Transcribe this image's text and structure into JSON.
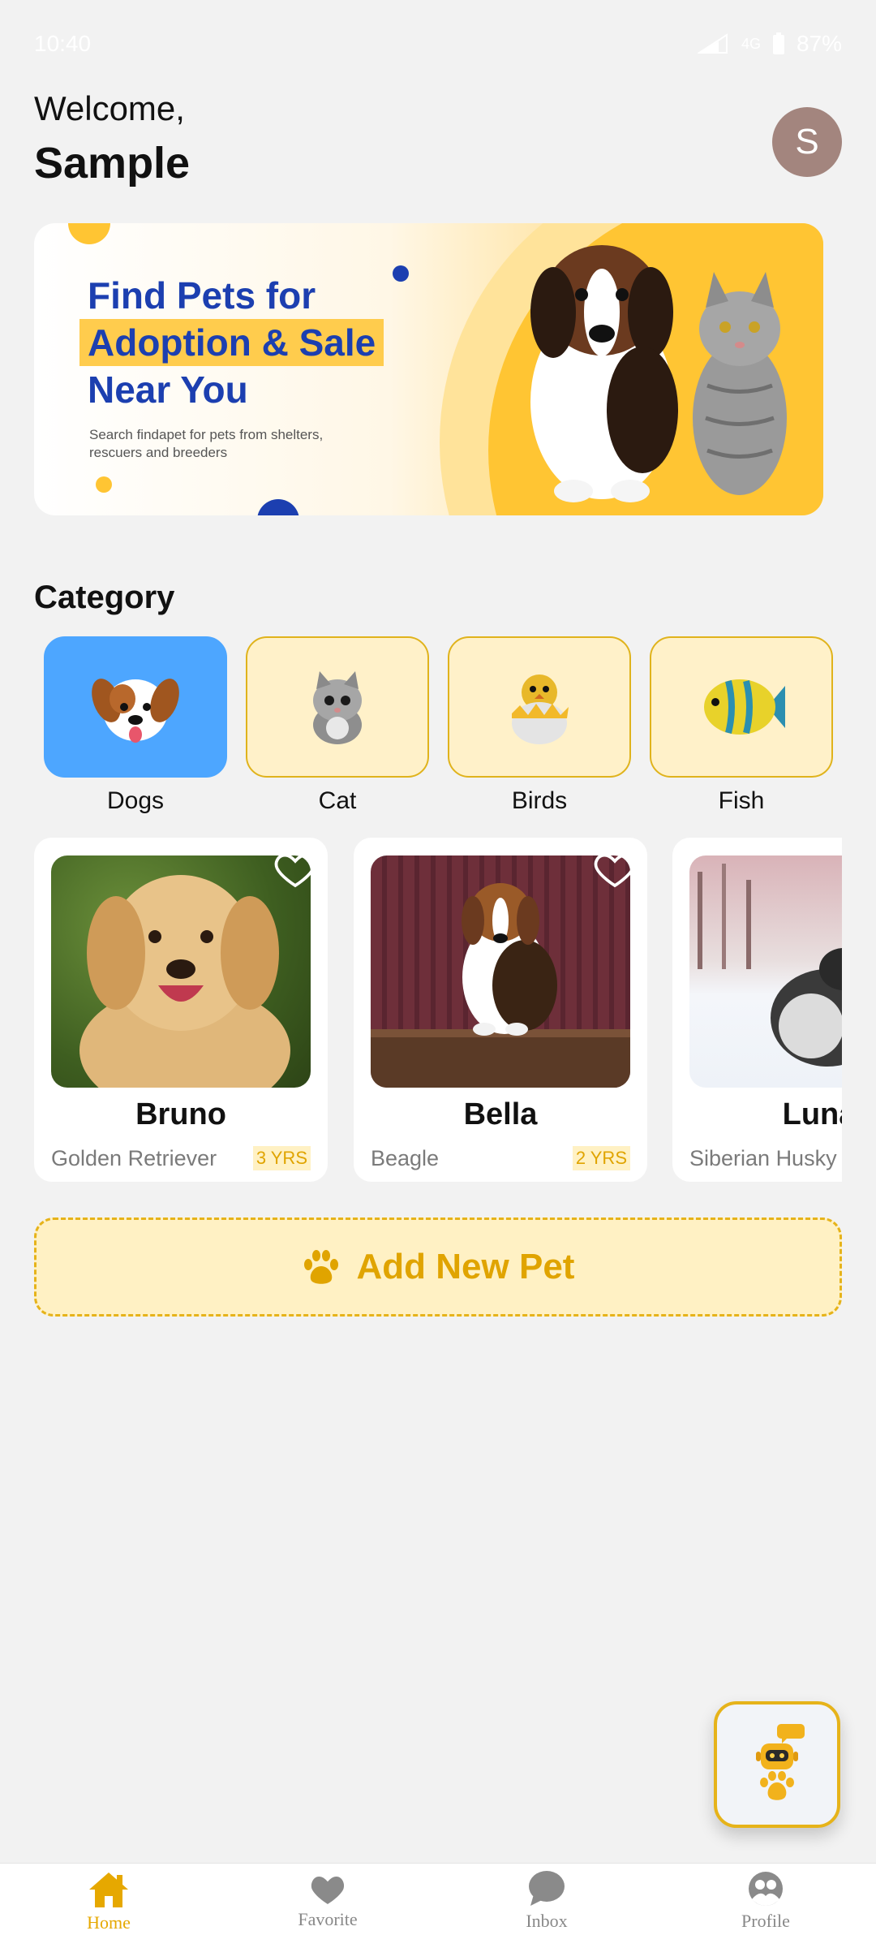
{
  "status_bar": {
    "time": "10:40",
    "network": "4G",
    "battery": "87%"
  },
  "header": {
    "welcome": "Welcome,",
    "user_name": "Sample",
    "avatar_letter": "S"
  },
  "banner": {
    "line1": "Find Pets for",
    "line2": "Adoption & Sale",
    "line3": "Near You",
    "subtitle": "Search findapet for pets from shelters, rescuers and breeders"
  },
  "category": {
    "title": "Category",
    "items": [
      {
        "label": "Dogs",
        "icon": "dog-face-icon",
        "active": true
      },
      {
        "label": "Cat",
        "icon": "cat-icon",
        "active": false
      },
      {
        "label": "Birds",
        "icon": "hatching-chick-icon",
        "active": false
      },
      {
        "label": "Fish",
        "icon": "tropical-fish-icon",
        "active": false
      }
    ]
  },
  "pets": [
    {
      "name": "Bruno",
      "breed": "Golden Retriever",
      "age": "3 YRS"
    },
    {
      "name": "Bella",
      "breed": "Beagle",
      "age": "2 YRS"
    },
    {
      "name": "Luna",
      "breed": "Siberian Husky",
      "age": ""
    }
  ],
  "add_pet": {
    "label": "Add New Pet",
    "icon": "paw-icon"
  },
  "fab": {
    "icon": "robot-assistant-icon"
  },
  "bottom_nav": {
    "items": [
      {
        "label": "Home",
        "icon": "home-icon",
        "active": true
      },
      {
        "label": "Favorite",
        "icon": "heart-icon",
        "active": false
      },
      {
        "label": "Inbox",
        "icon": "chat-bubble-icon",
        "active": false
      },
      {
        "label": "Profile",
        "icon": "profile-icon",
        "active": false
      }
    ]
  },
  "colors": {
    "accent": "#e6a800",
    "active_category": "#4da6ff",
    "banner_blue": "#1c3fb0",
    "avatar": "#a3857e"
  }
}
